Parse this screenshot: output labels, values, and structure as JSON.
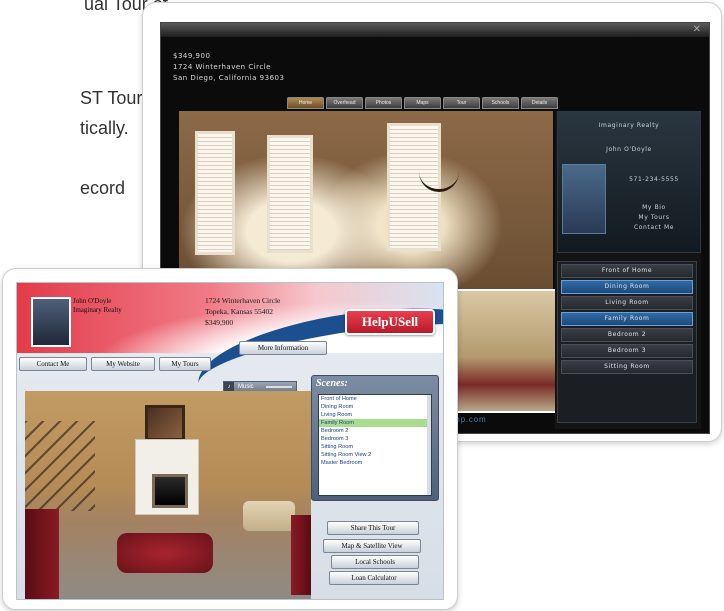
{
  "background_text": {
    "line1": "ual Tour of",
    "line2": "ST Tour",
    "line3": "tically.",
    "line4": "ecord"
  },
  "back_tour": {
    "listing": {
      "price": "$349,900",
      "street": "1724 Winterhaven Circle",
      "city": "San Diego, California 93603"
    },
    "tabs": [
      "Home",
      "Overhead",
      "Photos",
      "Maps",
      "Tour",
      "Schools",
      "Details"
    ],
    "panel": {
      "company": "Imaginary Realty",
      "agent": "John O'Doyle",
      "phone": "571-234-5555",
      "link1": "My Bio",
      "link2": "My Tours",
      "link3": "Contact Me"
    },
    "scenes": [
      "Front of Home",
      "Dining Room",
      "Living Room",
      "Family Room",
      "Bedroom 2",
      "Bedroom 3",
      "Sitting Room"
    ],
    "selected_scene": "Family Room",
    "url": "Panatemp.com",
    "accent": "#2f6aa5"
  },
  "front_tour": {
    "agent": {
      "name": "John O'Doyle",
      "company": "Imaginary Realty"
    },
    "address": {
      "street": "1724 Winterhaven Circle",
      "city": "Topeka, Kansas 55402",
      "price": "$349,900"
    },
    "logo": "HelpUSell",
    "buttons": {
      "contact": "Contact Me",
      "website": "My Website",
      "tours": "My Tours",
      "more_info": "More Information",
      "share": "Share This Tour",
      "map": "Map & Satellite View",
      "schools": "Local Schools",
      "loan": "Loan Calculator"
    },
    "music_label": "Music",
    "scenes_title": "Scenes:",
    "scenes": [
      "Front of Home",
      "Dining Room",
      "Living Room",
      "Family Room",
      "Bedroom 2",
      "Bedroom 3",
      "Sitting Room",
      "Sitting Room View 2",
      "Master Bedroom"
    ],
    "selected_scene": "Family Room",
    "colors": {
      "brand_red": "#e43b4a",
      "brand_blue": "#1b4f8f",
      "scene_select": "#a9dc8f"
    }
  }
}
